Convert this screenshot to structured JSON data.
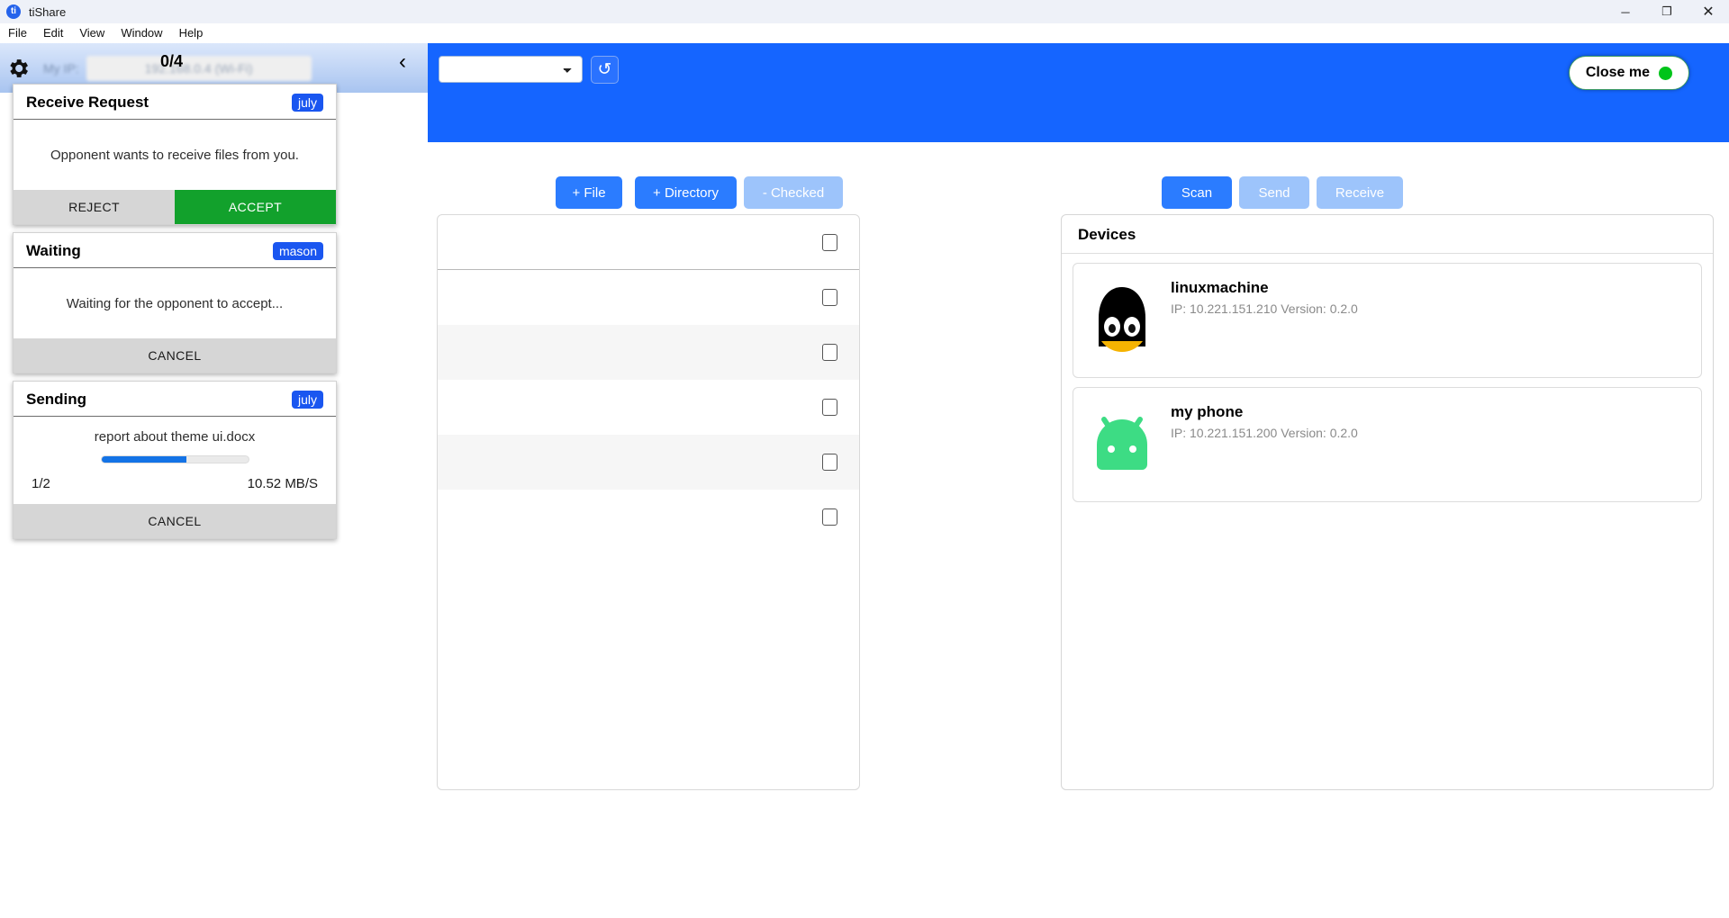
{
  "window": {
    "app_icon": "ti",
    "title": "tiShare",
    "controls": {
      "minimize": "─",
      "maximize": "❐",
      "close": "✕"
    }
  },
  "menubar": {
    "items": [
      "File",
      "Edit",
      "View",
      "Window",
      "Help"
    ]
  },
  "ip_strip": {
    "gear_icon": "gear-icon",
    "label": "My IP:",
    "value": "192.168.0.4 (Wi-Fi)",
    "counter": "0/4",
    "collapse_icon": "‹"
  },
  "header": {
    "select_value": "",
    "refresh_icon": "↺",
    "close_me_label": "Close me",
    "close_me_status_color": "#00c41a"
  },
  "toolbar": {
    "add_file_label": "+ File",
    "add_directory_label": "+ Directory",
    "remove_checked_label": "- Checked",
    "scan_label": "Scan",
    "send_label": "Send",
    "receive_label": "Receive"
  },
  "file_list": {
    "rows": [
      {
        "checked": false,
        "alt": false
      },
      {
        "checked": false,
        "alt": false
      },
      {
        "checked": false,
        "alt": true
      },
      {
        "checked": false,
        "alt": false
      },
      {
        "checked": false,
        "alt": true
      },
      {
        "checked": false,
        "alt": false
      }
    ]
  },
  "devices": {
    "title": "Devices",
    "items": [
      {
        "icon": "penguin-icon",
        "name": "linuxmachine",
        "meta": "IP: 10.221.151.210 Version: 0.2.0"
      },
      {
        "icon": "android-icon",
        "name": "my phone",
        "meta": "IP: 10.221.151.200 Version: 0.2.0"
      }
    ]
  },
  "notifications": [
    {
      "kind": "receive-request",
      "title": "Receive Request",
      "badge": "july",
      "message": "Opponent wants to receive files from you.",
      "buttons": [
        {
          "label": "REJECT",
          "style": "neutral"
        },
        {
          "label": "ACCEPT",
          "style": "accept"
        }
      ]
    },
    {
      "kind": "waiting",
      "title": "Waiting",
      "badge": "mason",
      "message": "Waiting for the opponent to accept...",
      "buttons": [
        {
          "label": "CANCEL",
          "style": "neutral"
        }
      ]
    },
    {
      "kind": "sending",
      "title": "Sending",
      "badge": "july",
      "filename": "report about theme ui.docx",
      "progress_percent": 58,
      "count": "1/2",
      "speed": "10.52 MB/S",
      "buttons": [
        {
          "label": "CANCEL",
          "style": "neutral"
        }
      ]
    }
  ],
  "colors": {
    "brand_blue": "#1565ff",
    "accent_blue": "#2b7cff",
    "muted_blue": "#9dc4fb",
    "accept_green": "#12a12c",
    "badge_blue": "#1a56f0"
  }
}
